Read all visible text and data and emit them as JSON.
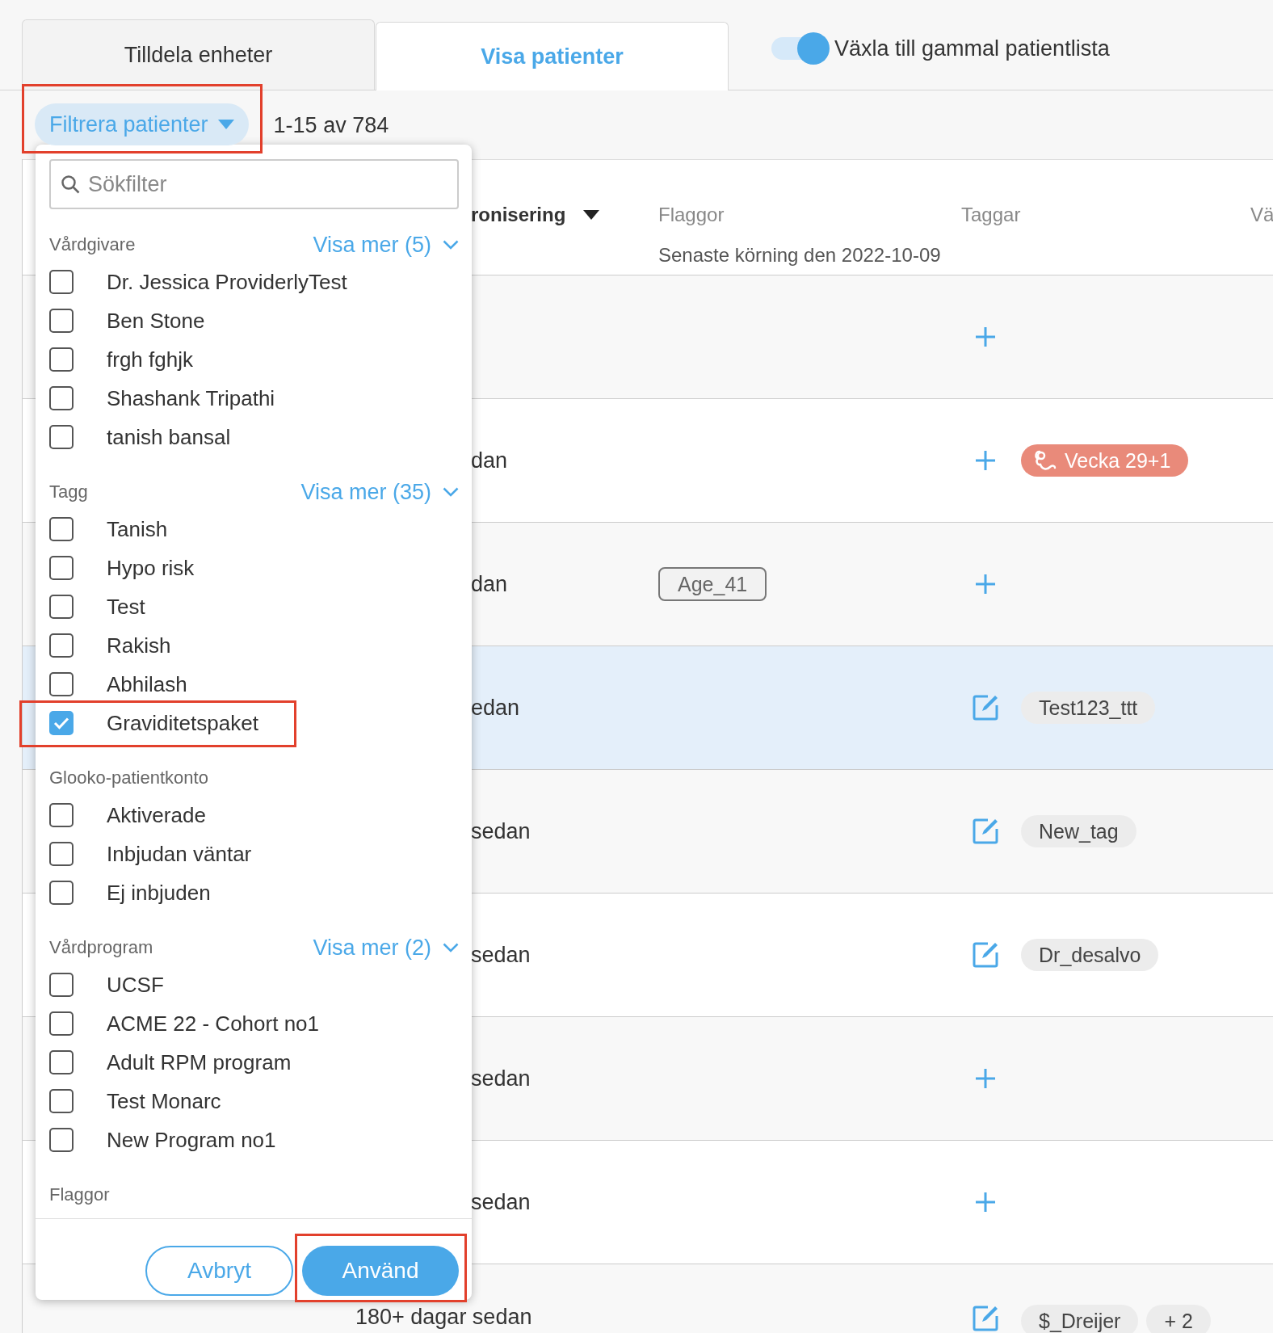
{
  "tabs": [
    {
      "label": "Tilldela enheter",
      "selected": false
    },
    {
      "label": "Visa patienter",
      "selected": true
    }
  ],
  "legacy_toggle": {
    "label": "Växla till gammal patientlista",
    "on": true
  },
  "filter_button": {
    "label": "Filtrera patienter",
    "highlighted": true
  },
  "result_count": "1-15 av 784",
  "table": {
    "columns": [
      {
        "label": "ronisering",
        "sorted": true,
        "covered": true
      },
      {
        "label": "Flaggor",
        "sorted": false,
        "covered": false
      },
      {
        "label": "Taggar",
        "sorted": false,
        "covered": false
      },
      {
        "label": "Vä",
        "sorted": false,
        "covered": false
      }
    ],
    "subheader": "Senaste körning den 2022-10-09",
    "rows": [
      {
        "kind": "add",
        "selected": false
      },
      {
        "time": "dan",
        "covered": true,
        "kind": "add",
        "tags": [
          {
            "label": "Vecka 29+1",
            "kind": "pregnancy"
          }
        ],
        "selected": false
      },
      {
        "time": "dan",
        "covered": true,
        "flags": [
          "Age_41"
        ],
        "kind": "add",
        "selected": false
      },
      {
        "time": "edan",
        "covered": true,
        "kind": "edit",
        "tags": [
          {
            "label": "Test123_ttt",
            "kind": "plain"
          }
        ],
        "selected": true
      },
      {
        "time": "sedan",
        "covered": true,
        "kind": "edit",
        "tags": [
          {
            "label": "New_tag",
            "kind": "plain"
          }
        ],
        "selected": false
      },
      {
        "time": "sedan",
        "covered": true,
        "kind": "edit",
        "tags": [
          {
            "label": "Dr_desalvo",
            "kind": "plain"
          }
        ],
        "selected": false
      },
      {
        "time": "sedan",
        "covered": true,
        "kind": "add",
        "selected": false
      },
      {
        "time": "sedan",
        "covered": true,
        "kind": "add",
        "selected": false
      },
      {
        "time": "180+ dagar sedan",
        "covered": false,
        "kind": "edit",
        "tags": [
          {
            "label": "$_Dreijer",
            "kind": "plain"
          },
          {
            "label": "+ 2",
            "kind": "plain"
          }
        ],
        "selected": false
      }
    ]
  },
  "filter_panel": {
    "search": {
      "placeholder": "Sökfilter"
    },
    "sections": [
      {
        "title": "Vårdgivare",
        "more": "Visa mer (5)",
        "items": [
          {
            "label": "Dr. Jessica ProviderlyTest",
            "checked": false,
            "highlighted": false
          },
          {
            "label": "Ben Stone",
            "checked": false,
            "highlighted": false
          },
          {
            "label": "frgh fghjk",
            "checked": false,
            "highlighted": false
          },
          {
            "label": "Shashank Tripathi",
            "checked": false,
            "highlighted": false
          },
          {
            "label": "tanish bansal",
            "checked": false,
            "highlighted": false
          }
        ]
      },
      {
        "title": "Tagg",
        "more": "Visa mer (35)",
        "items": [
          {
            "label": "Tanish",
            "checked": false,
            "highlighted": false
          },
          {
            "label": "Hypo risk",
            "checked": false,
            "highlighted": false
          },
          {
            "label": "Test",
            "checked": false,
            "highlighted": false
          },
          {
            "label": "Rakish",
            "checked": false,
            "highlighted": false
          },
          {
            "label": "Abhilash",
            "checked": false,
            "highlighted": false
          },
          {
            "label": "Graviditetspaket",
            "checked": true,
            "highlighted": true
          }
        ]
      },
      {
        "title": "Glooko-patientkonto",
        "items": [
          {
            "label": "Aktiverade",
            "checked": false,
            "highlighted": false
          },
          {
            "label": "Inbjudan väntar",
            "checked": false,
            "highlighted": false
          },
          {
            "label": "Ej inbjuden",
            "checked": false,
            "highlighted": false
          }
        ]
      },
      {
        "title": "Vårdprogram",
        "more": "Visa mer (2)",
        "items": [
          {
            "label": "UCSF",
            "checked": false,
            "highlighted": false
          },
          {
            "label": "ACME 22 - Cohort no1",
            "checked": false,
            "highlighted": false
          },
          {
            "label": "Adult RPM program",
            "checked": false,
            "highlighted": false
          },
          {
            "label": "Test Monarc",
            "checked": false,
            "highlighted": false
          },
          {
            "label": "New Program no1",
            "checked": false,
            "highlighted": false
          }
        ]
      },
      {
        "title": "Flaggor"
      }
    ],
    "cancel_button": {
      "label": "Avbryt"
    },
    "apply_button": {
      "label": "Använd",
      "highlighted": true
    }
  }
}
